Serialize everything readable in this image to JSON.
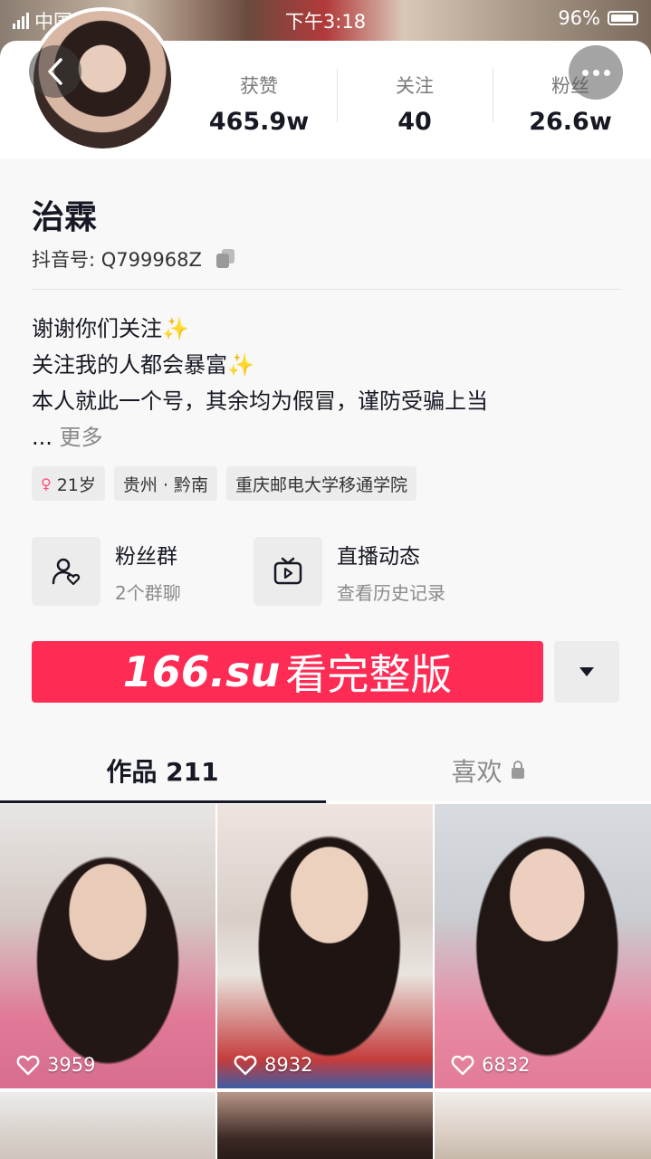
{
  "status_bar": {
    "carrier": "中国电信",
    "time": "下午3:18",
    "battery": "96%"
  },
  "profile": {
    "name": "治霖",
    "id_label": "抖音号: Q799968Z",
    "stats": [
      {
        "label": "获赞",
        "value": "465.9w"
      },
      {
        "label": "关注",
        "value": "40"
      },
      {
        "label": "粉丝",
        "value": "26.6w"
      }
    ],
    "bio": [
      {
        "text": "谢谢你们关注",
        "sparkle": "✨"
      },
      {
        "text": "关注我的人都会暴富",
        "sparkle": "✨"
      },
      {
        "text": "本人就此一个号，其余均为假冒，谨防受骗上当",
        "sparkle": ""
      }
    ],
    "bio_ellipsis": "...",
    "bio_more": "更多",
    "tags": [
      {
        "label": "21岁",
        "icon": "female-icon"
      },
      {
        "label": "贵州 · 黔南"
      },
      {
        "label": "重庆邮电大学移通学院"
      }
    ]
  },
  "groups": [
    {
      "title": "粉丝群",
      "subtitle": "2个群聊",
      "icon": "fan-group-icon"
    },
    {
      "title": "直播动态",
      "subtitle": "查看历史记录",
      "icon": "live-tv-icon"
    }
  ],
  "cta": {
    "brand": "166.su",
    "label": "看完整版"
  },
  "tabs": [
    {
      "label": "作品 211",
      "active": true
    },
    {
      "label": "喜欢",
      "active": false,
      "icon": "lock-icon"
    }
  ],
  "videos": [
    {
      "likes": "3959"
    },
    {
      "likes": "8932"
    },
    {
      "likes": "6832"
    },
    {
      "likes": ""
    },
    {
      "likes": ""
    },
    {
      "likes": ""
    }
  ],
  "colors": {
    "accent": "#fe2c55",
    "text": "#161823",
    "muted": "#8a8a8a",
    "panel": "#f8f8f8"
  }
}
